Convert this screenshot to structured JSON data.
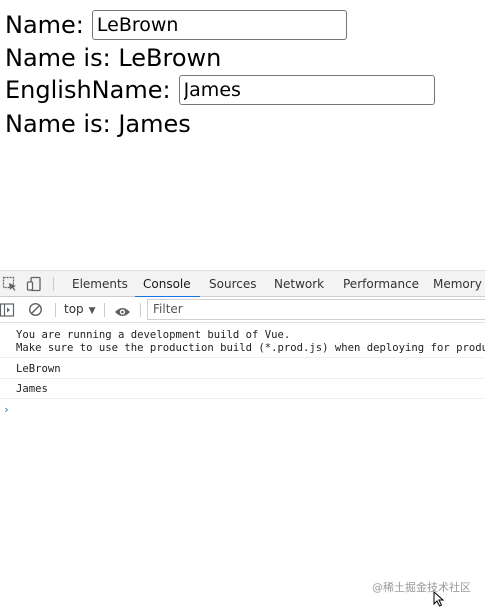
{
  "app": {
    "name_label": "Name:",
    "name_value": "LeBrown",
    "name_display": "Name is: LeBrown",
    "english_label": "EnglishName:",
    "english_value": "James",
    "english_display": "Name is: James"
  },
  "devtools": {
    "tabs": [
      "Elements",
      "Console",
      "Sources",
      "Network",
      "Performance",
      "Memory"
    ],
    "active_tab": "Console",
    "context": "top",
    "filter_placeholder": "Filter",
    "messages": [
      "You are running a development build of Vue.\nMake sure to use the production build (*.prod.js) when deploying for production.",
      "LeBrown",
      "James"
    ],
    "prompt_symbol": "›"
  },
  "watermark": "@稀土掘金技术社区",
  "colors": {
    "accent": "#1a73e8",
    "tabbar_bg": "#f3f3f3"
  }
}
